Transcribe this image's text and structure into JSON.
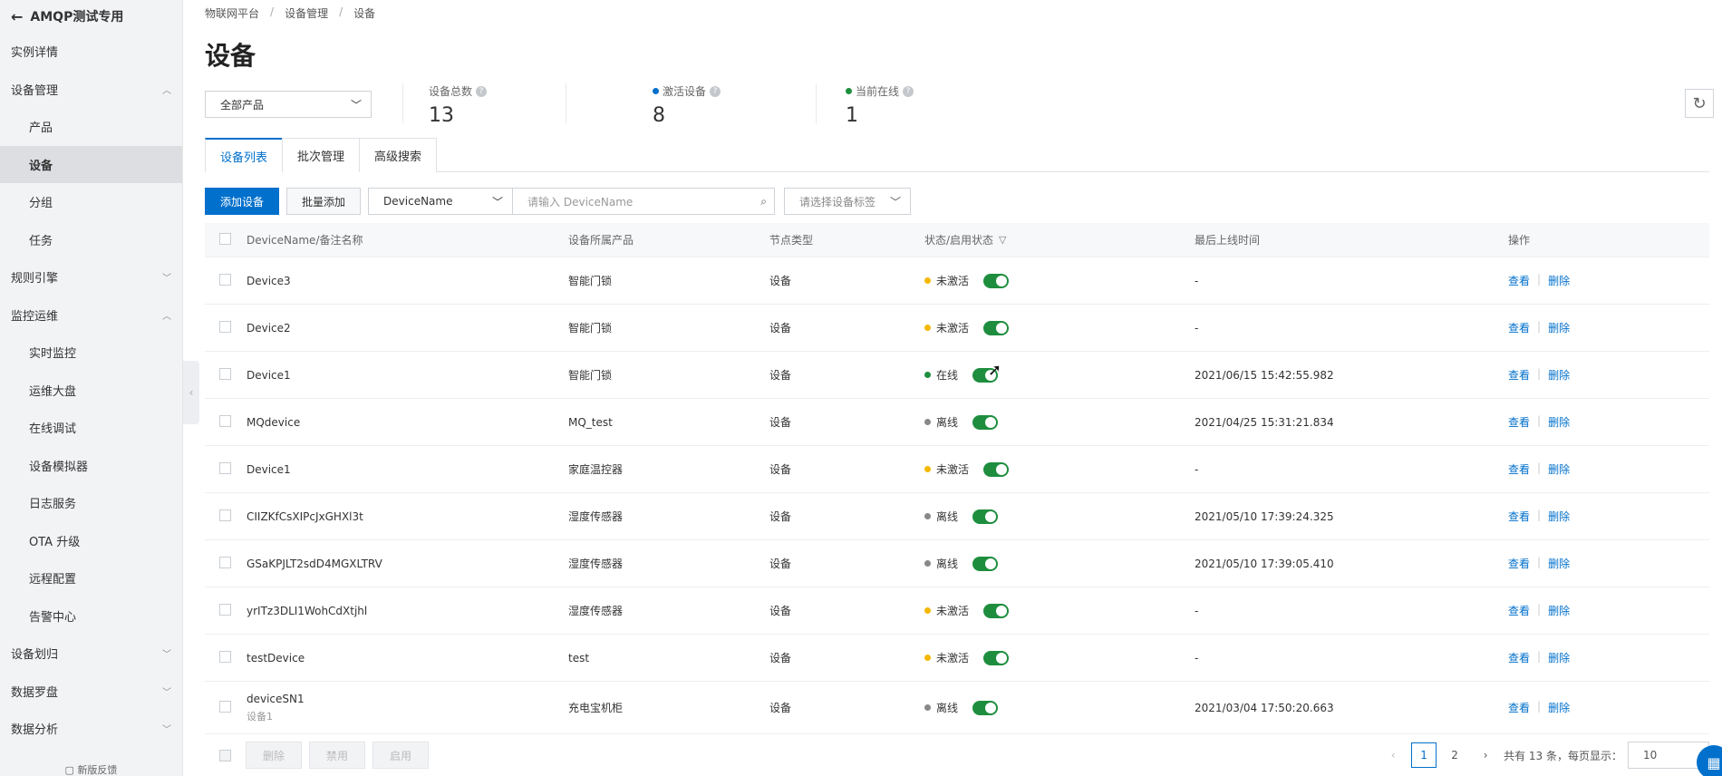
{
  "sidebar": {
    "title": "AMQP测试专用",
    "items": [
      {
        "label": "实例详情",
        "level": 0,
        "chevron": ""
      },
      {
        "label": "设备管理",
        "level": 0,
        "chevron": "up"
      },
      {
        "label": "产品",
        "level": 1,
        "chevron": ""
      },
      {
        "label": "设备",
        "level": 1,
        "chevron": "",
        "active": true
      },
      {
        "label": "分组",
        "level": 1,
        "chevron": ""
      },
      {
        "label": "任务",
        "level": 1,
        "chevron": ""
      },
      {
        "label": "规则引擎",
        "level": 0,
        "chevron": "down"
      },
      {
        "label": "监控运维",
        "level": 0,
        "chevron": "up"
      },
      {
        "label": "实时监控",
        "level": 1,
        "chevron": ""
      },
      {
        "label": "运维大盘",
        "level": 1,
        "chevron": ""
      },
      {
        "label": "在线调试",
        "level": 1,
        "chevron": ""
      },
      {
        "label": "设备模拟器",
        "level": 1,
        "chevron": ""
      },
      {
        "label": "日志服务",
        "level": 1,
        "chevron": ""
      },
      {
        "label": "OTA 升级",
        "level": 1,
        "chevron": ""
      },
      {
        "label": "远程配置",
        "level": 1,
        "chevron": ""
      },
      {
        "label": "告警中心",
        "level": 1,
        "chevron": ""
      },
      {
        "label": "设备划归",
        "level": 0,
        "chevron": "down"
      },
      {
        "label": "数据罗盘",
        "level": 0,
        "chevron": "down"
      },
      {
        "label": "数据分析",
        "level": 0,
        "chevron": "down"
      }
    ],
    "footer": "新版反馈"
  },
  "breadcrumb": [
    "物联网平台",
    "设备管理",
    "设备"
  ],
  "page_title": "设备",
  "product_select": "全部产品",
  "stats": {
    "total": {
      "label": "设备总数",
      "value": "13"
    },
    "active": {
      "label": "激活设备",
      "value": "8",
      "dot_color": "#0070cc"
    },
    "online": {
      "label": "当前在线",
      "value": "1",
      "dot_color": "#1e8e3e"
    }
  },
  "tabs": [
    "设备列表",
    "批次管理",
    "高级搜索"
  ],
  "toolbar": {
    "add": "添加设备",
    "batch_add": "批量添加",
    "search_field": "DeviceName",
    "search_placeholder": "请输入 DeviceName",
    "tag_placeholder": "请选择设备标签"
  },
  "table": {
    "headers": [
      "DeviceName/备注名称",
      "设备所属产品",
      "节点类型",
      "状态/启用状态",
      "最后上线时间",
      "操作"
    ],
    "rows": [
      {
        "name": "Device3",
        "note": "",
        "product": "智能门锁",
        "node": "设备",
        "status": "未激活",
        "status_color": "#f5b800",
        "last": "-"
      },
      {
        "name": "Device2",
        "note": "",
        "product": "智能门锁",
        "node": "设备",
        "status": "未激活",
        "status_color": "#f5b800",
        "last": "-"
      },
      {
        "name": "Device1",
        "note": "",
        "product": "智能门锁",
        "node": "设备",
        "status": "在线",
        "status_color": "#1e8e3e",
        "last": "2021/06/15 15:42:55.982"
      },
      {
        "name": "MQdevice",
        "note": "",
        "product": "MQ_test",
        "node": "设备",
        "status": "离线",
        "status_color": "#888888",
        "last": "2021/04/25 15:31:21.834"
      },
      {
        "name": "Device1",
        "note": "",
        "product": "家庭温控器",
        "node": "设备",
        "status": "未激活",
        "status_color": "#f5b800",
        "last": "-"
      },
      {
        "name": "CIIZKfCsXIPcJxGHXl3t",
        "note": "",
        "product": "湿度传感器",
        "node": "设备",
        "status": "离线",
        "status_color": "#888888",
        "last": "2021/05/10 17:39:24.325"
      },
      {
        "name": "GSaKPJLT2sdD4MGXLTRV",
        "note": "",
        "product": "湿度传感器",
        "node": "设备",
        "status": "离线",
        "status_color": "#888888",
        "last": "2021/05/10 17:39:05.410"
      },
      {
        "name": "yrITz3DLI1WohCdXtjhl",
        "note": "",
        "product": "湿度传感器",
        "node": "设备",
        "status": "未激活",
        "status_color": "#f5b800",
        "last": "-"
      },
      {
        "name": "testDevice",
        "note": "",
        "product": "test",
        "node": "设备",
        "status": "未激活",
        "status_color": "#f5b800",
        "last": "-"
      },
      {
        "name": "deviceSN1",
        "note": "设备1",
        "product": "充电宝机柜",
        "node": "设备",
        "status": "离线",
        "status_color": "#888888",
        "last": "2021/03/04 17:50:20.663"
      }
    ],
    "actions": [
      "查看",
      "删除"
    ]
  },
  "footer": {
    "bulk": [
      "删除",
      "禁用",
      "启用"
    ],
    "pages": [
      "1",
      "2"
    ],
    "current_page": "1",
    "total_text": "共有 13 条，每页显示：",
    "page_size": "10"
  },
  "colors": {
    "primary": "#0070cc",
    "switch_on": "#1e8e3e"
  }
}
